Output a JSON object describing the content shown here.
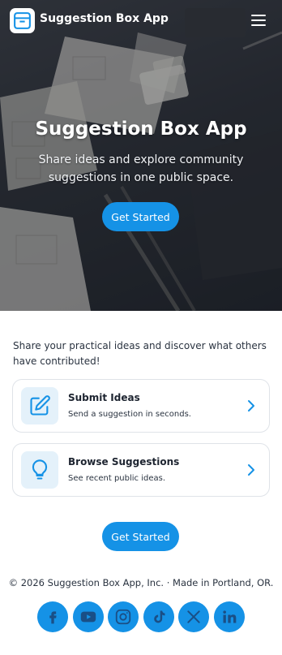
{
  "header": {
    "app_name": "Suggestion Box App",
    "logo_icon": "box-icon",
    "menu_icon": "hamburger-menu-icon"
  },
  "hero": {
    "title": "Suggestion Box App",
    "subtitle": "Share ideas and explore community suggestions in one public space.",
    "cta_label": "Get Started"
  },
  "main": {
    "intro": "Share your practical ideas and discover what others have contributed!",
    "cards": [
      {
        "title": "Submit Ideas",
        "description": "Send a suggestion in seconds.",
        "icon": "pencil-edit-icon"
      },
      {
        "title": "Browse Suggestions",
        "description": "See recent public ideas.",
        "icon": "lightbulb-icon"
      }
    ],
    "cta_label": "Get Started"
  },
  "footer": {
    "copyright": "© 2026 Suggestion Box App, Inc. · Made in Portland, OR.",
    "social": [
      "facebook-icon",
      "youtube-icon",
      "instagram-icon",
      "tiktok-icon",
      "x-icon",
      "linkedin-icon"
    ]
  },
  "colors": {
    "accent": "#1592e6",
    "icon_tile": "#e4f1fa",
    "card_border": "#dfe3e8"
  }
}
